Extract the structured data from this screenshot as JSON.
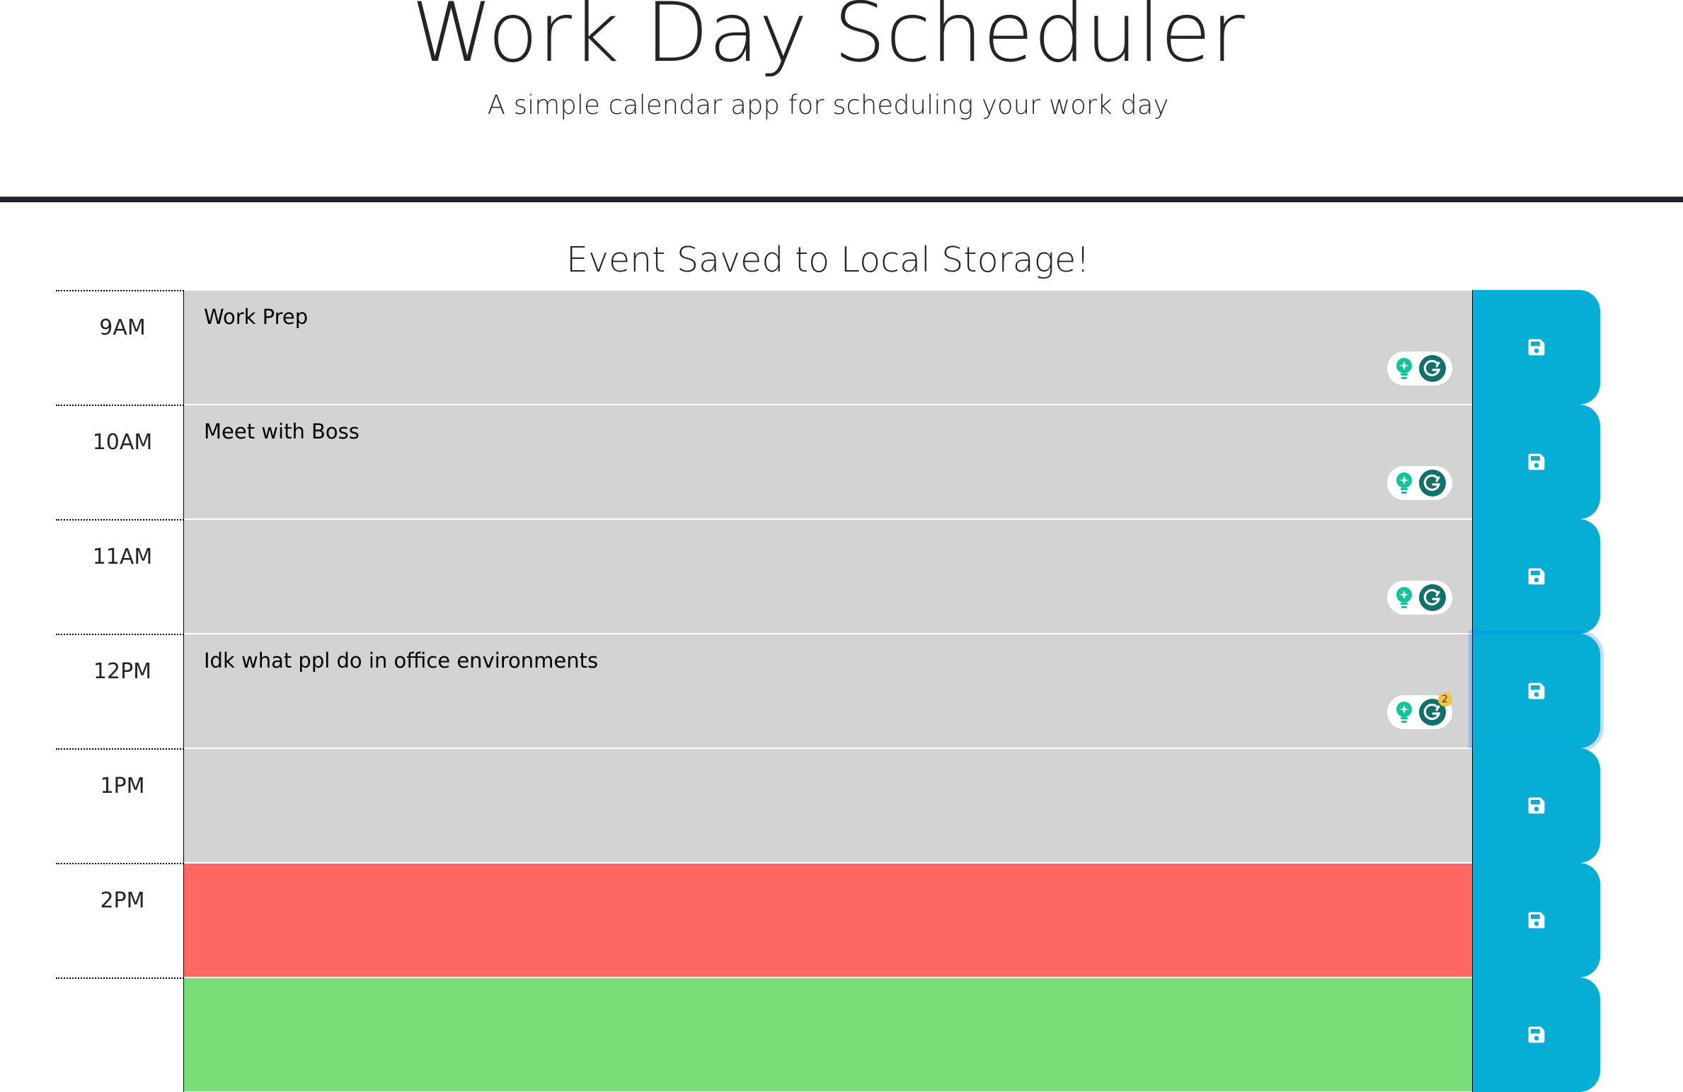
{
  "header": {
    "title": "Work Day Scheduler",
    "lead": "A simple calendar app for scheduling your work day"
  },
  "status_message": "Event Saved to Local Storage!",
  "colors": {
    "past": "#d3d3d3",
    "present": "#ff6961",
    "future": "#77dd77",
    "save_button": "#06aed5",
    "grammarly_green": "#15c39a",
    "grammarly_dark": "#11706a"
  },
  "time_blocks": [
    {
      "hour": "9AM",
      "text": "Work Prep",
      "state": "past",
      "grammarly": true,
      "badge": ""
    },
    {
      "hour": "10AM",
      "text": "Meet with Boss",
      "state": "past",
      "grammarly": true,
      "badge": ""
    },
    {
      "hour": "11AM",
      "text": "",
      "state": "past",
      "grammarly": true,
      "badge": ""
    },
    {
      "hour": "12PM",
      "text": "Idk what ppl do in office environments",
      "state": "past",
      "grammarly": true,
      "badge": "2",
      "focused_save": true
    },
    {
      "hour": "1PM",
      "text": "",
      "state": "past",
      "grammarly": false,
      "badge": ""
    },
    {
      "hour": "2PM",
      "text": "",
      "state": "present",
      "grammarly": false,
      "badge": ""
    },
    {
      "hour": "",
      "text": "",
      "state": "future",
      "grammarly": false,
      "badge": ""
    }
  ],
  "icons": {
    "save": "floppy-disk-icon",
    "grammarly_suggest": "lightbulb-icon",
    "grammarly_logo": "grammarly-g-icon"
  }
}
